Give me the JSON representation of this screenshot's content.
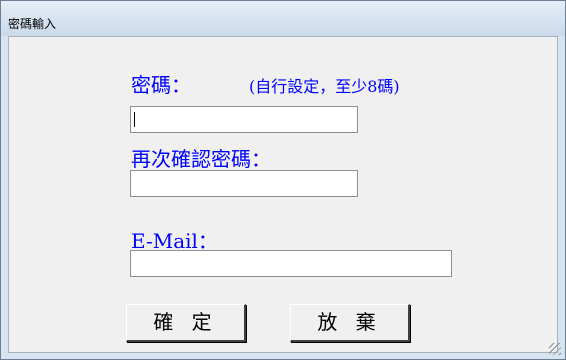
{
  "window": {
    "title": "密碼輸入"
  },
  "form": {
    "password_label": "密碼：",
    "password_hint": "(自行設定，至少8碼)",
    "password_value": "",
    "confirm_label": "再次確認密碼：",
    "confirm_value": "",
    "email_label": "E-Mail：",
    "email_value": ""
  },
  "buttons": {
    "ok_label": "確 定",
    "cancel_label": "放 棄"
  }
}
